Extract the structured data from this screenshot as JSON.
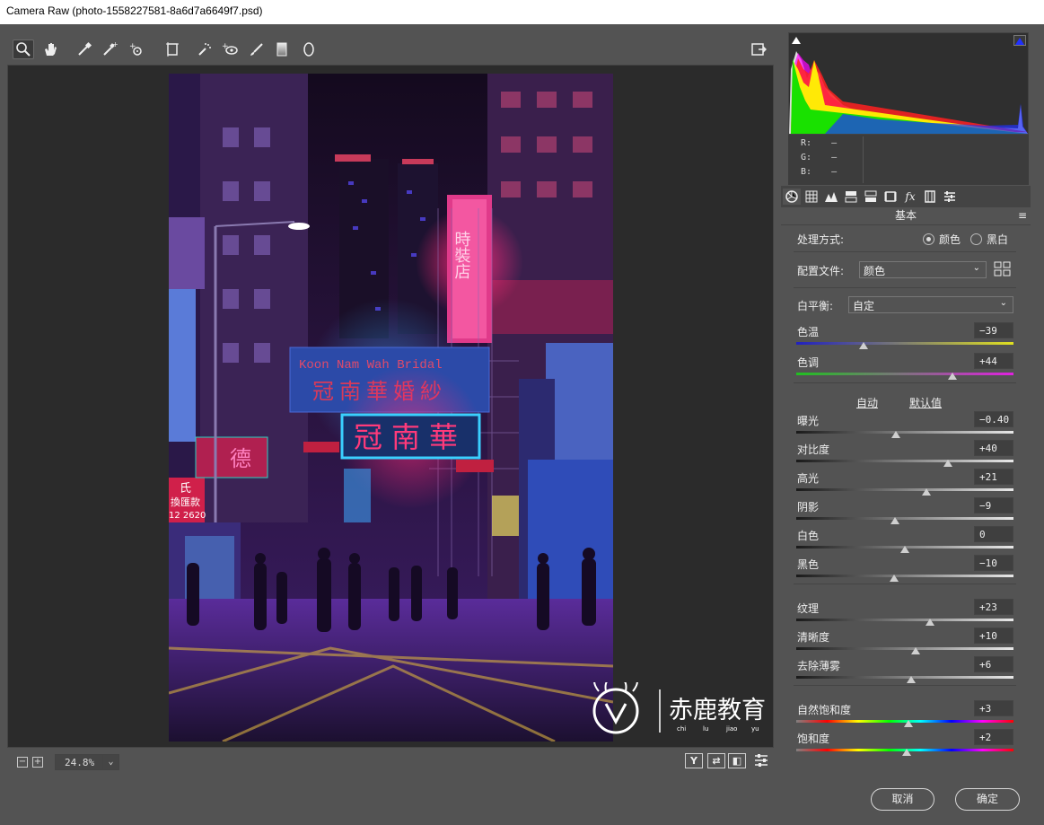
{
  "window": {
    "title": "Camera Raw (photo-1558227581-8a6d7a6649f7.psd)"
  },
  "toolbar": {
    "tools": [
      "zoom-icon",
      "hand-icon",
      "white-balance-icon",
      "color-sampler-icon",
      "targeted-adjust-icon",
      "transform-icon",
      "spot-removal-icon",
      "red-eye-icon",
      "adjustment-brush-icon",
      "graduated-filter-icon",
      "radial-filter-icon"
    ],
    "open_preferences_icon": "toggle-fullscreen-icon"
  },
  "photo": {
    "signs": {
      "top_english": "Koon Nam Wah Bridal",
      "top_chinese": "冠南華婚紗",
      "neon_main": "冠南華",
      "left_sign_1": "氏",
      "left_sign_2": "換匯款",
      "left_sign_3": "12 2620",
      "left_neon": "德",
      "vertical_neon": "時裝店"
    },
    "watermark": {
      "text": "赤鹿教育",
      "pinyin": [
        "chi",
        "lu",
        "jiao",
        "yu"
      ]
    }
  },
  "status": {
    "zoom_minus": "−",
    "zoom_plus": "+",
    "zoom": "24.8%",
    "icons": [
      "Y",
      "⇄",
      "◧"
    ]
  },
  "histogram": {
    "colors": {
      "red": "#ff2020",
      "yellow": "#ffff00",
      "green": "#00e000",
      "magenta": "#ff00ff",
      "blue": "#2030ff",
      "white": "#dcdcdc"
    }
  },
  "rgb": {
    "r_label": "R:",
    "g_label": "G:",
    "b_label": "B:",
    "r": "—",
    "g": "—",
    "b": "—"
  },
  "panel": {
    "section_title": "基本",
    "treatment_label": "处理方式:",
    "treatment_color": "颜色",
    "treatment_bw": "黑白",
    "profile_label": "配置文件:",
    "profile_value": "颜色",
    "wb_label": "白平衡:",
    "wb_value": "自定",
    "auto_link": "自动",
    "default_link": "默认值",
    "sliders": [
      {
        "id": "temp",
        "label": "色温",
        "value": "−39",
        "pos": 0.31
      },
      {
        "id": "tint",
        "label": "色调",
        "value": "+44",
        "pos": 0.72
      },
      {
        "id": "exposure",
        "label": "曝光",
        "value": "−0.40",
        "pos": 0.46
      },
      {
        "id": "contrast",
        "label": "对比度",
        "value": "+40",
        "pos": 0.7
      },
      {
        "id": "highlights",
        "label": "高光",
        "value": "+21",
        "pos": 0.6
      },
      {
        "id": "shadows",
        "label": "阴影",
        "value": "−9",
        "pos": 0.455
      },
      {
        "id": "whites",
        "label": "白色",
        "value": "0",
        "pos": 0.5
      },
      {
        "id": "blacks",
        "label": "黑色",
        "value": "−10",
        "pos": 0.45
      },
      {
        "id": "texture",
        "label": "纹理",
        "value": "+23",
        "pos": 0.615
      },
      {
        "id": "clarity",
        "label": "清晰度",
        "value": "+10",
        "pos": 0.55
      },
      {
        "id": "dehaze",
        "label": "去除薄雾",
        "value": "+6",
        "pos": 0.53
      },
      {
        "id": "vibrance",
        "label": "自然饱和度",
        "value": "+3",
        "pos": 0.515
      },
      {
        "id": "saturation",
        "label": "饱和度",
        "value": "+2",
        "pos": 0.51
      }
    ]
  },
  "buttons": {
    "cancel": "取消",
    "ok": "确定"
  }
}
